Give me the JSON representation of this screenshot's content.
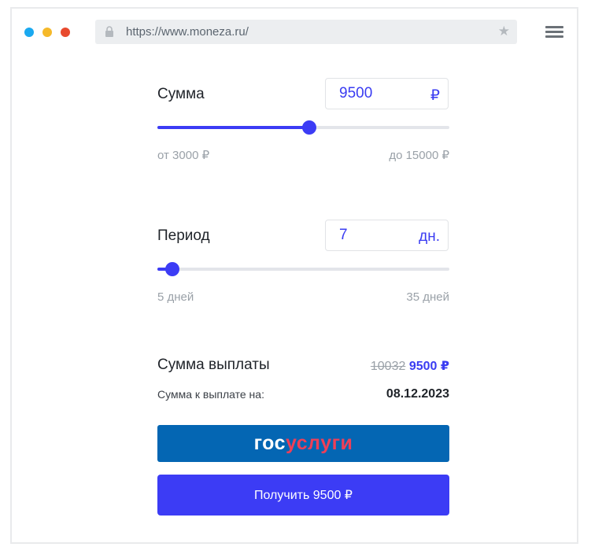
{
  "browser": {
    "url": "https://www.moneza.ru/",
    "traffic_lights": [
      "#1aa9f0",
      "#f5b92a",
      "#e84a2e"
    ]
  },
  "amount": {
    "label": "Сумма",
    "value": "9500",
    "unit": "₽",
    "min_label": "от 3000 ₽",
    "max_label": "до 15000 ₽",
    "slider_fraction": 0.52
  },
  "period": {
    "label": "Период",
    "value": "7",
    "unit": "дн.",
    "min_label": "5 дней",
    "max_label": "35 дней",
    "slider_fraction": 0.05
  },
  "payout": {
    "label": "Сумма выплаты",
    "old_amount": "10032",
    "new_amount": "9500 ₽",
    "date_label": "Сумма к выплате на:",
    "date_value": "08.12.2023"
  },
  "buttons": {
    "gosuslugi_gos": "гос",
    "gosuslugi_uslugi": "услуги",
    "get_label": "Получить 9500 ₽"
  },
  "colors": {
    "accent": "#3c3cf5",
    "gosuslugi_blue": "#0466b3",
    "gosuslugi_red": "#ee3f58"
  },
  "icons": {
    "lock": "lock-icon",
    "star": "star-icon",
    "menu": "hamburger-menu-icon"
  }
}
